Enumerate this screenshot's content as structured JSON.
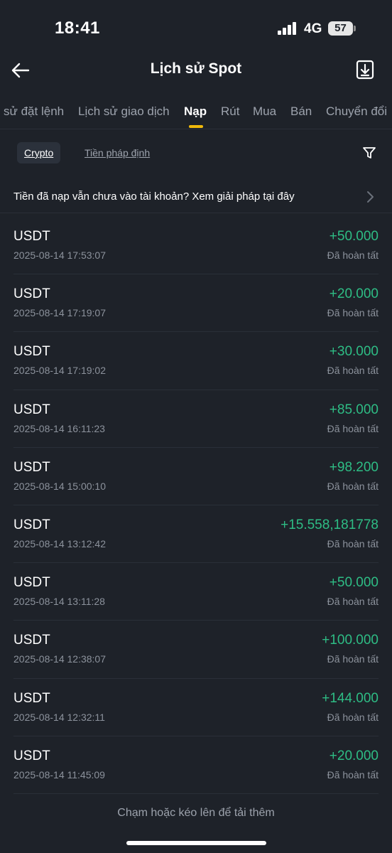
{
  "status": {
    "time": "18:41",
    "network": "4G",
    "battery": "57"
  },
  "header": {
    "title": "Lịch sử Spot"
  },
  "tabs": [
    {
      "label": "sử đặt lệnh"
    },
    {
      "label": "Lịch sử giao dịch"
    },
    {
      "label": "Nạp"
    },
    {
      "label": "Rút"
    },
    {
      "label": "Mua"
    },
    {
      "label": "Bán"
    },
    {
      "label": "Chuyển đổi"
    }
  ],
  "filters": {
    "chip1": "Crypto",
    "chip2": "Tiền pháp định"
  },
  "notice": "Tiền đã nạp vẫn chưa vào tài khoản? Xem giải pháp tại đây",
  "records": [
    {
      "coin": "USDT",
      "time": "2025-08-14 17:53:07",
      "amount": "+50.000",
      "status": "Đã hoàn tất"
    },
    {
      "coin": "USDT",
      "time": "2025-08-14 17:19:07",
      "amount": "+20.000",
      "status": "Đã hoàn tất"
    },
    {
      "coin": "USDT",
      "time": "2025-08-14 17:19:02",
      "amount": "+30.000",
      "status": "Đã hoàn tất"
    },
    {
      "coin": "USDT",
      "time": "2025-08-14 16:11:23",
      "amount": "+85.000",
      "status": "Đã hoàn tất"
    },
    {
      "coin": "USDT",
      "time": "2025-08-14 15:00:10",
      "amount": "+98.200",
      "status": "Đã hoàn tất"
    },
    {
      "coin": "USDT",
      "time": "2025-08-14 13:12:42",
      "amount": "+15.558,181778",
      "status": "Đã hoàn tất"
    },
    {
      "coin": "USDT",
      "time": "2025-08-14 13:11:28",
      "amount": "+50.000",
      "status": "Đã hoàn tất"
    },
    {
      "coin": "USDT",
      "time": "2025-08-14 12:38:07",
      "amount": "+100.000",
      "status": "Đã hoàn tất"
    },
    {
      "coin": "USDT",
      "time": "2025-08-14 12:32:11",
      "amount": "+144.000",
      "status": "Đã hoàn tất"
    },
    {
      "coin": "USDT",
      "time": "2025-08-14 11:45:09",
      "amount": "+20.000",
      "status": "Đã hoàn tất"
    }
  ],
  "load_more": "Chạm hoặc kéo lên để tải thêm",
  "colors": {
    "background": "#1e2229",
    "positive": "#2ebd85",
    "accent": "#f0b90b"
  }
}
